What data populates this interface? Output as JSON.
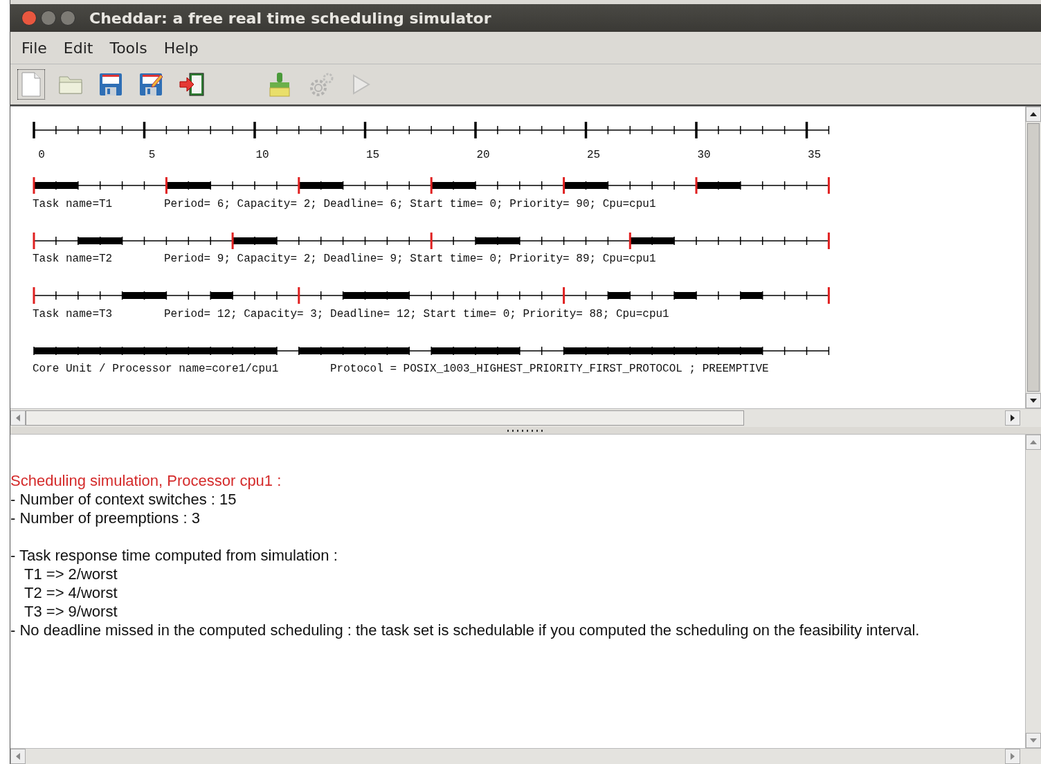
{
  "window": {
    "title": "Cheddar: a free real time scheduling simulator"
  },
  "menu": [
    {
      "label": "File"
    },
    {
      "label": "Edit"
    },
    {
      "label": "Tools"
    },
    {
      "label": "Help"
    }
  ],
  "toolbar": [
    {
      "kind": "new",
      "disabled": false,
      "focused": true
    },
    {
      "kind": "open",
      "disabled": false,
      "focused": false
    },
    {
      "kind": "save",
      "disabled": false,
      "focused": false
    },
    {
      "kind": "save_as",
      "disabled": false,
      "focused": false
    },
    {
      "kind": "exit",
      "disabled": false,
      "focused": false
    },
    {
      "kind": "spacer"
    },
    {
      "kind": "clean",
      "disabled": false,
      "focused": false
    },
    {
      "kind": "settings",
      "disabled": true,
      "focused": false
    },
    {
      "kind": "run",
      "disabled": true,
      "focused": false
    }
  ],
  "schedule": {
    "axis_labels": [
      "0",
      "5",
      "10",
      "15",
      "20",
      "25",
      "30",
      "35"
    ],
    "rows": [
      {
        "name": "Task name=T1",
        "details": "Period= 6; Capacity= 2; Deadline= 6; Start time= 0; Priority= 90; Cpu=cpu1",
        "busy": [
          true,
          true,
          false,
          false,
          false,
          false,
          true,
          true,
          false,
          false,
          false,
          false,
          true,
          true,
          false,
          false,
          false,
          false,
          true,
          true,
          false,
          false,
          false,
          false,
          true,
          true,
          false,
          false,
          false,
          false,
          true,
          true,
          false,
          false,
          false,
          false
        ],
        "release": [
          true,
          false,
          false,
          false,
          false,
          false,
          true,
          false,
          false,
          false,
          false,
          false,
          true,
          false,
          false,
          false,
          false,
          false,
          true,
          false,
          false,
          false,
          false,
          false,
          true,
          false,
          false,
          false,
          false,
          false,
          true,
          false,
          false,
          false,
          false,
          false,
          true
        ]
      },
      {
        "name": "Task name=T2",
        "details": "Period= 9; Capacity= 2; Deadline= 9; Start time= 0; Priority= 89; Cpu=cpu1",
        "busy": [
          false,
          false,
          true,
          true,
          false,
          false,
          false,
          false,
          false,
          true,
          true,
          false,
          false,
          false,
          false,
          false,
          false,
          false,
          false,
          false,
          true,
          true,
          false,
          false,
          false,
          false,
          false,
          true,
          true,
          false,
          false,
          false,
          false,
          false,
          false,
          false
        ],
        "release": [
          true,
          false,
          false,
          false,
          false,
          false,
          false,
          false,
          false,
          true,
          false,
          false,
          false,
          false,
          false,
          false,
          false,
          false,
          true,
          false,
          false,
          false,
          false,
          false,
          false,
          false,
          false,
          true,
          false,
          false,
          false,
          false,
          false,
          false,
          false,
          false,
          true
        ]
      },
      {
        "name": "Task name=T3",
        "details": "Period= 12; Capacity= 3; Deadline= 12; Start time= 0; Priority= 88; Cpu=cpu1",
        "busy": [
          false,
          false,
          false,
          false,
          true,
          true,
          false,
          false,
          true,
          false,
          false,
          false,
          false,
          false,
          true,
          true,
          true,
          false,
          false,
          false,
          false,
          false,
          false,
          false,
          false,
          false,
          true,
          false,
          false,
          true,
          false,
          false,
          true,
          false,
          false,
          false
        ],
        "release": [
          true,
          false,
          false,
          false,
          false,
          false,
          false,
          false,
          false,
          false,
          false,
          false,
          true,
          false,
          false,
          false,
          false,
          false,
          false,
          false,
          false,
          false,
          false,
          false,
          true,
          false,
          false,
          false,
          false,
          false,
          false,
          false,
          false,
          false,
          false,
          false,
          true
        ]
      },
      {
        "name": "Core Unit / Processor name=core1/cpu1",
        "details": "Protocol = POSIX_1003_HIGHEST_PRIORITY_FIRST_PROTOCOL ; PREEMPTIVE",
        "busy": [
          true,
          true,
          true,
          true,
          true,
          true,
          true,
          true,
          true,
          true,
          true,
          false,
          true,
          true,
          true,
          true,
          true,
          false,
          true,
          true,
          true,
          true,
          false,
          false,
          true,
          true,
          true,
          true,
          true,
          true,
          true,
          true,
          true,
          false,
          false,
          false
        ],
        "release": [
          false,
          false,
          false,
          false,
          false,
          false,
          false,
          false,
          false,
          false,
          false,
          false,
          false,
          false,
          false,
          false,
          false,
          false,
          false,
          false,
          false,
          false,
          false,
          false,
          false,
          false,
          false,
          false,
          false,
          false,
          false,
          false,
          false,
          false,
          false,
          false,
          false
        ]
      }
    ]
  },
  "output": [
    {
      "kind": "heading",
      "text": "Scheduling simulation, Processor cpu1 :"
    },
    {
      "kind": "bullet",
      "text": "- Number of context switches :  15"
    },
    {
      "kind": "bullet",
      "text": "- Number of preemptions :  3"
    },
    {
      "kind": "gap"
    },
    {
      "kind": "bullet",
      "text": "- Task response time computed from simulation :"
    },
    {
      "kind": "indent",
      "text": "T1 => 2/worst"
    },
    {
      "kind": "indent",
      "text": "T2 => 4/worst"
    },
    {
      "kind": "indent",
      "text": "T3 => 9/worst"
    },
    {
      "kind": "bullet",
      "text": "- No deadline missed in the computed scheduling : the task set is schedulable if you computed the scheduling on the feasibility interval."
    }
  ]
}
